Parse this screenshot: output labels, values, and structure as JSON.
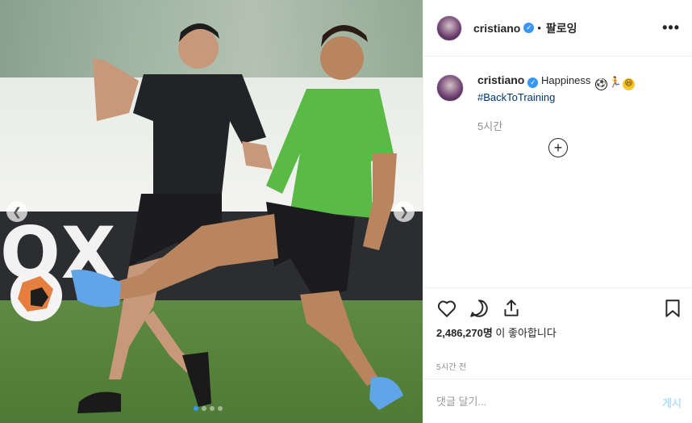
{
  "post": {
    "username": "cristiano",
    "verified_icon": "verified-badge-icon",
    "separator": "•",
    "follow_label": "팔로잉",
    "more_label": "•••"
  },
  "caption": {
    "username": "cristiano",
    "text": "Happiness",
    "emojis": [
      "⚽",
      "🏃",
      "😆"
    ],
    "hashtag": "#BackToTraining",
    "time": "5시간"
  },
  "media": {
    "board_text": "OX",
    "carousel_dots": 4,
    "active_dot": 0
  },
  "actions": {
    "like_icon": "heart-icon",
    "comment_icon": "comment-icon",
    "share_icon": "share-icon",
    "save_icon": "bookmark-icon"
  },
  "likes": {
    "count": "2,486,270명",
    "suffix": " 이 좋아합니다"
  },
  "posted_time": "5시간 전",
  "comment": {
    "placeholder": "댓글 달기...",
    "post_label": "게시"
  },
  "colors": {
    "accent": "#3897f0",
    "hashtag": "#003569",
    "muted": "#8e8e8e",
    "post_disabled": "#b2dffc"
  }
}
